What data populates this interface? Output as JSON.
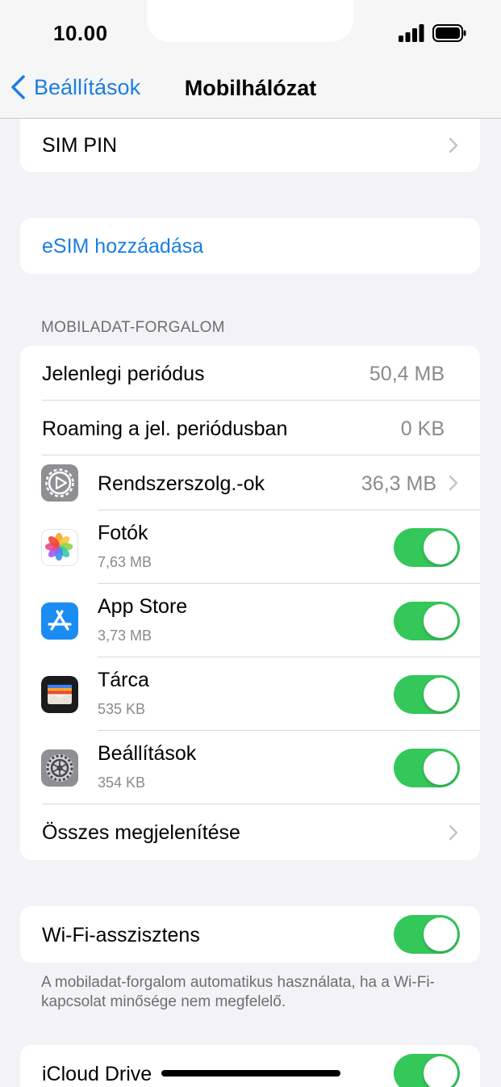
{
  "status_bar": {
    "time": "10.00"
  },
  "nav": {
    "back_label": "Beállítások",
    "title": "Mobilhálózat"
  },
  "sim_pin": {
    "label": "SIM PIN"
  },
  "esim": {
    "label": "eSIM hozzáadása"
  },
  "mobile_data": {
    "header": "MOBILADAT-FORGALOM",
    "current_period": {
      "label": "Jelenlegi periódus",
      "value": "50,4 MB"
    },
    "roaming": {
      "label": "Roaming a jel. periódusban",
      "value": "0 KB"
    },
    "system_services": {
      "label": "Rendszerszolg.-ok",
      "value": "36,3 MB",
      "icon": "system-services-icon"
    },
    "apps": [
      {
        "name": "Fotók",
        "usage": "7,63 MB",
        "enabled": true,
        "icon": "photos-icon"
      },
      {
        "name": "App Store",
        "usage": "3,73 MB",
        "enabled": true,
        "icon": "app-store-icon"
      },
      {
        "name": "Tárca",
        "usage": "535 KB",
        "enabled": true,
        "icon": "wallet-icon"
      },
      {
        "name": "Beállítások",
        "usage": "354 KB",
        "enabled": true,
        "icon": "settings-icon"
      }
    ],
    "show_all": {
      "label": "Összes megjelenítése"
    }
  },
  "wifi_assist": {
    "label": "Wi-Fi-asszisztens",
    "enabled": true,
    "footnote": "A mobiladat-forgalom automatikus használata, ha a Wi-Fi-kapcsolat minősége nem megfelelő."
  },
  "icloud_drive": {
    "label": "iCloud Drive",
    "enabled": true
  },
  "colors": {
    "accent": "#1a7ee4",
    "toggle_on": "#34c759",
    "background": "#f2f2f7"
  }
}
